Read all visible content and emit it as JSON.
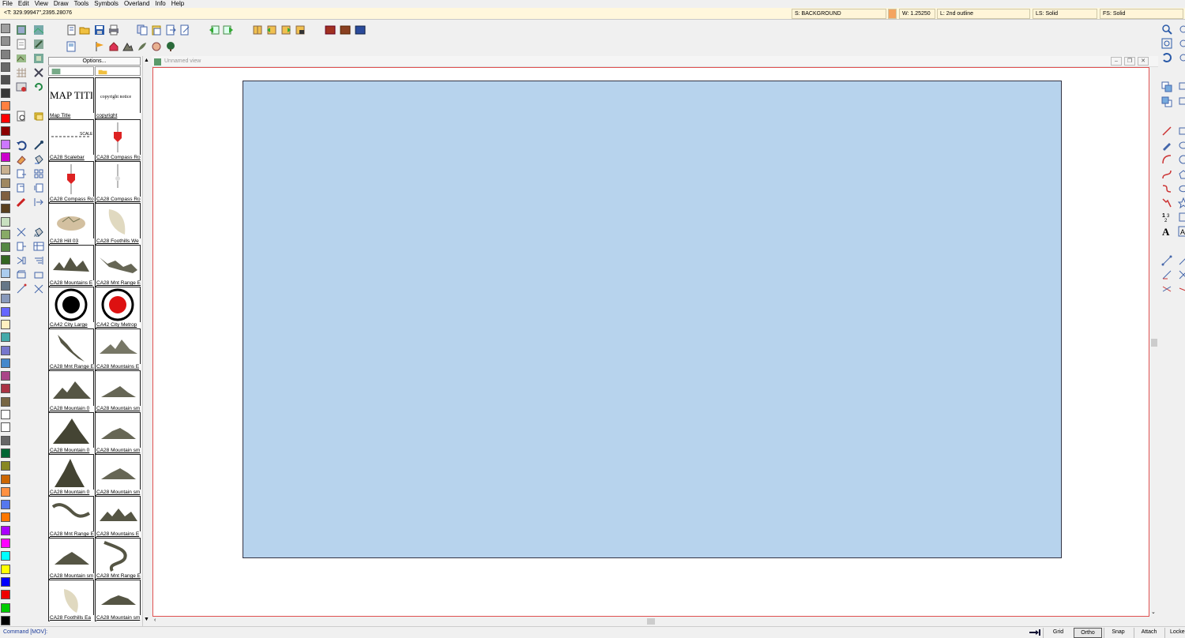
{
  "menu": [
    "File",
    "Edit",
    "View",
    "Draw",
    "Tools",
    "Symbols",
    "Overland",
    "Info",
    "Help"
  ],
  "status": {
    "coords": "<T: 329.99947\",2395.28076",
    "sheet": "S: BACKGROUND",
    "sheet_color": "#f4a460",
    "width": "W: 1.25250",
    "layer": "L: 2nd outline",
    "line_style": "LS: Solid",
    "fill_style": "FS: Solid"
  },
  "catalog": {
    "options_label": "Options...",
    "symbols": [
      "Map Title",
      "copyright",
      "CA28 Scalebar",
      "CA28 Compass Ro",
      "CA28 Compass Ro",
      "CA28 Compass Ro",
      "CA28 Hill 03",
      "CA28 Foothills We",
      "CA28 Mountains E",
      "CA28 Mnt Range E",
      "CA42 City Large",
      "CA42 City Metrop",
      "CA28 Mnt Range E",
      "CA28 Mountains E",
      "CA28 Mountain 0",
      "CA28 Mountain sm",
      "CA28 Mountain 0",
      "CA28 Mountain sm",
      "CA28 Mountain 0",
      "CA28 Mountain sm",
      "CA28 Mnt Range E",
      "CA28 Mountains E",
      "CA28 Mountain sm",
      "CA28 Mnt Range E",
      "CA28 Foothills Ea",
      "CA28 Mountain sm"
    ],
    "title_art_text": "MAP TITLE",
    "copyright_art_text": "copyright notice",
    "scalebar_art_text": "SCALE"
  },
  "view": {
    "title": "Unnamed view"
  },
  "map": {
    "background_color": "#b7d3ed"
  },
  "palette": [
    "#a0a0a0",
    "#909090",
    "#808080",
    "#6a6a6a",
    "#505050",
    "#383838",
    "#ff8040",
    "#ff0000",
    "#8b0000",
    "#cc77ff",
    "#cc00cc",
    "#c8b090",
    "#a08860",
    "#806040",
    "#5a4020",
    "#c8e0c0",
    "#88aa66",
    "#558844",
    "#336622",
    "#aaccee",
    "#667788",
    "#8899bb",
    "#6666ff",
    "#fff0c0",
    "#44aaaa",
    "#7777cc",
    "#4488cc",
    "#aa4488",
    "#aa3344",
    "#776644",
    "#ffffff",
    "#ffffff",
    "#666666",
    "#006633",
    "#888822",
    "#cc6600",
    "#ff9040",
    "#5577ee",
    "#ff7700",
    "#aa00ff",
    "#ff00ff",
    "#00ffff",
    "#ffff00",
    "#0000ff",
    "#ee0000",
    "#00cc00",
    "#000000"
  ],
  "command": "Command [MOV]:",
  "modes": {
    "grid": "Grid",
    "ortho": "Ortho",
    "snap": "Snap",
    "attach": "Attach",
    "locked": "Locke"
  }
}
